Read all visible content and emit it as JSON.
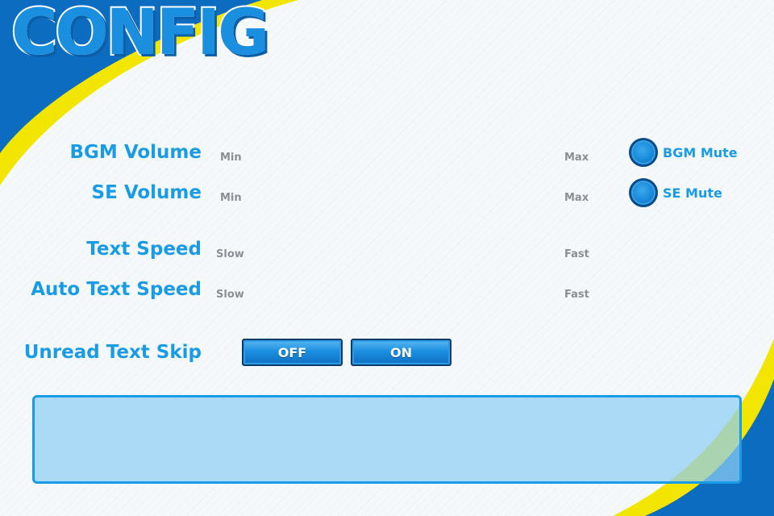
{
  "title": "CONFIG",
  "settings": {
    "bgm_volume": {
      "label": "BGM Volume",
      "min": "Min",
      "max": "Max"
    },
    "se_volume": {
      "label": "SE Volume",
      "min": "Min",
      "max": "Max"
    },
    "text_speed": {
      "label": "Text Speed",
      "min": "Slow",
      "max": "Fast"
    },
    "auto_text_speed": {
      "label": "Auto Text Speed",
      "min": "Slow",
      "max": "Fast"
    },
    "unread_text_skip": {
      "label": "Unread Text Skip",
      "off": "OFF",
      "on": "ON"
    }
  },
  "mutes": {
    "bgm": "BGM Mute",
    "se": "SE Mute"
  },
  "message_box": "",
  "colors": {
    "accent": "#1a9be6",
    "dark_blue": "#0b5ea8",
    "yellow": "#f2e600"
  }
}
